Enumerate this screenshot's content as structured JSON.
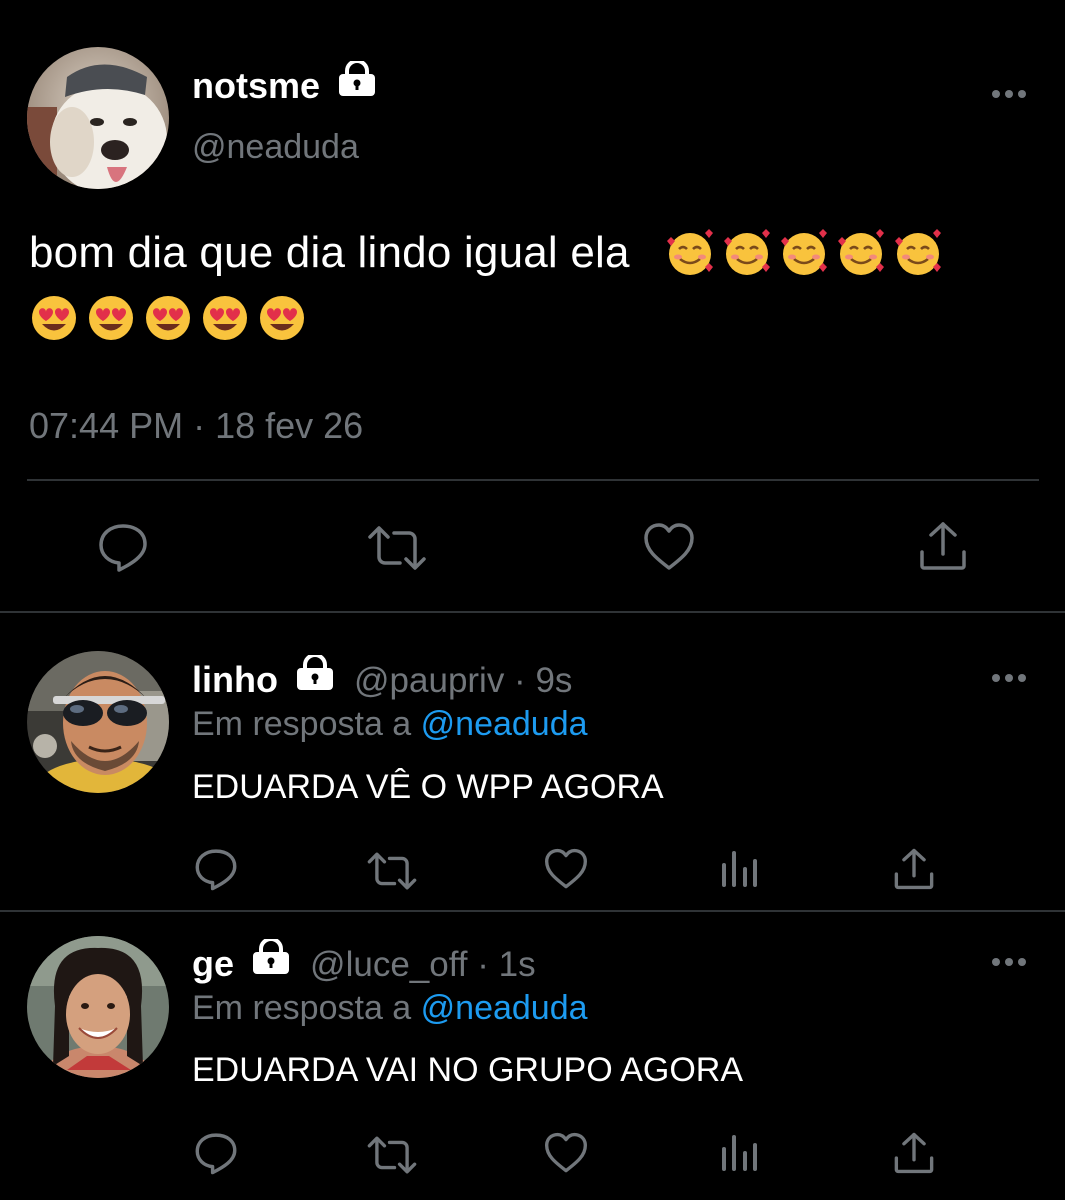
{
  "main_tweet": {
    "display_name": "notsme",
    "handle": "@neaduda",
    "text": "bom dia que dia lindo igual ela",
    "emojis_line1": [
      "smiling-face-with-hearts",
      "smiling-face-with-hearts",
      "smiling-face-with-hearts",
      "smiling-face-with-hearts",
      "smiling-face-with-hearts"
    ],
    "emojis_line2": [
      "heart-eyes",
      "heart-eyes",
      "heart-eyes",
      "heart-eyes",
      "heart-eyes"
    ],
    "timestamp": "07:44 PM · 18 fev 26",
    "actions": [
      "reply-icon",
      "retweet-icon",
      "like-icon",
      "share-icon"
    ]
  },
  "replies": [
    {
      "display_name": "linho",
      "handle": "@paupriv · 9s",
      "reply_prefix": "Em resposta a ",
      "reply_to": "@neaduda",
      "text": "EDUARDA VÊ O WPP AGORA",
      "actions": [
        "reply-icon",
        "retweet-icon",
        "like-icon",
        "analytics-icon",
        "share-icon"
      ]
    },
    {
      "display_name": "ge",
      "handle": "@luce_off · 1s",
      "reply_prefix": "Em resposta a ",
      "reply_to": "@neaduda",
      "text": "EDUARDA VAI NO GRUPO AGORA",
      "actions": [
        "reply-icon",
        "retweet-icon",
        "like-icon",
        "analytics-icon",
        "share-icon"
      ]
    }
  ],
  "colors": {
    "background": "#000000",
    "secondary_text": "#71767b",
    "link": "#1d9bf0",
    "divider": "#2f3336"
  }
}
